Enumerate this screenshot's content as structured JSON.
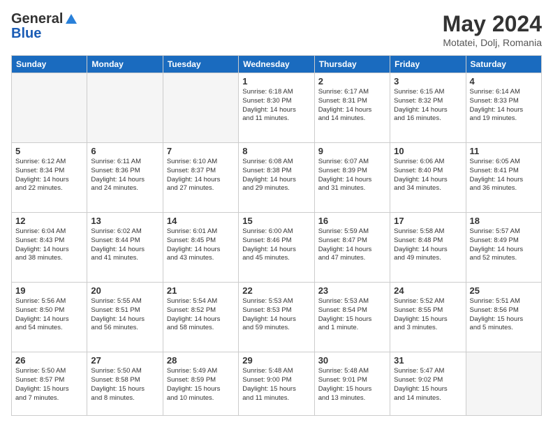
{
  "header": {
    "logo_general": "General",
    "logo_blue": "Blue",
    "month_title": "May 2024",
    "location": "Motatei, Dolj, Romania"
  },
  "days_of_week": [
    "Sunday",
    "Monday",
    "Tuesday",
    "Wednesday",
    "Thursday",
    "Friday",
    "Saturday"
  ],
  "weeks": [
    [
      {
        "day": "",
        "info": ""
      },
      {
        "day": "",
        "info": ""
      },
      {
        "day": "",
        "info": ""
      },
      {
        "day": "1",
        "info": "Sunrise: 6:18 AM\nSunset: 8:30 PM\nDaylight: 14 hours\nand 11 minutes."
      },
      {
        "day": "2",
        "info": "Sunrise: 6:17 AM\nSunset: 8:31 PM\nDaylight: 14 hours\nand 14 minutes."
      },
      {
        "day": "3",
        "info": "Sunrise: 6:15 AM\nSunset: 8:32 PM\nDaylight: 14 hours\nand 16 minutes."
      },
      {
        "day": "4",
        "info": "Sunrise: 6:14 AM\nSunset: 8:33 PM\nDaylight: 14 hours\nand 19 minutes."
      }
    ],
    [
      {
        "day": "5",
        "info": "Sunrise: 6:12 AM\nSunset: 8:34 PM\nDaylight: 14 hours\nand 22 minutes."
      },
      {
        "day": "6",
        "info": "Sunrise: 6:11 AM\nSunset: 8:36 PM\nDaylight: 14 hours\nand 24 minutes."
      },
      {
        "day": "7",
        "info": "Sunrise: 6:10 AM\nSunset: 8:37 PM\nDaylight: 14 hours\nand 27 minutes."
      },
      {
        "day": "8",
        "info": "Sunrise: 6:08 AM\nSunset: 8:38 PM\nDaylight: 14 hours\nand 29 minutes."
      },
      {
        "day": "9",
        "info": "Sunrise: 6:07 AM\nSunset: 8:39 PM\nDaylight: 14 hours\nand 31 minutes."
      },
      {
        "day": "10",
        "info": "Sunrise: 6:06 AM\nSunset: 8:40 PM\nDaylight: 14 hours\nand 34 minutes."
      },
      {
        "day": "11",
        "info": "Sunrise: 6:05 AM\nSunset: 8:41 PM\nDaylight: 14 hours\nand 36 minutes."
      }
    ],
    [
      {
        "day": "12",
        "info": "Sunrise: 6:04 AM\nSunset: 8:43 PM\nDaylight: 14 hours\nand 38 minutes."
      },
      {
        "day": "13",
        "info": "Sunrise: 6:02 AM\nSunset: 8:44 PM\nDaylight: 14 hours\nand 41 minutes."
      },
      {
        "day": "14",
        "info": "Sunrise: 6:01 AM\nSunset: 8:45 PM\nDaylight: 14 hours\nand 43 minutes."
      },
      {
        "day": "15",
        "info": "Sunrise: 6:00 AM\nSunset: 8:46 PM\nDaylight: 14 hours\nand 45 minutes."
      },
      {
        "day": "16",
        "info": "Sunrise: 5:59 AM\nSunset: 8:47 PM\nDaylight: 14 hours\nand 47 minutes."
      },
      {
        "day": "17",
        "info": "Sunrise: 5:58 AM\nSunset: 8:48 PM\nDaylight: 14 hours\nand 49 minutes."
      },
      {
        "day": "18",
        "info": "Sunrise: 5:57 AM\nSunset: 8:49 PM\nDaylight: 14 hours\nand 52 minutes."
      }
    ],
    [
      {
        "day": "19",
        "info": "Sunrise: 5:56 AM\nSunset: 8:50 PM\nDaylight: 14 hours\nand 54 minutes."
      },
      {
        "day": "20",
        "info": "Sunrise: 5:55 AM\nSunset: 8:51 PM\nDaylight: 14 hours\nand 56 minutes."
      },
      {
        "day": "21",
        "info": "Sunrise: 5:54 AM\nSunset: 8:52 PM\nDaylight: 14 hours\nand 58 minutes."
      },
      {
        "day": "22",
        "info": "Sunrise: 5:53 AM\nSunset: 8:53 PM\nDaylight: 14 hours\nand 59 minutes."
      },
      {
        "day": "23",
        "info": "Sunrise: 5:53 AM\nSunset: 8:54 PM\nDaylight: 15 hours\nand 1 minute."
      },
      {
        "day": "24",
        "info": "Sunrise: 5:52 AM\nSunset: 8:55 PM\nDaylight: 15 hours\nand 3 minutes."
      },
      {
        "day": "25",
        "info": "Sunrise: 5:51 AM\nSunset: 8:56 PM\nDaylight: 15 hours\nand 5 minutes."
      }
    ],
    [
      {
        "day": "26",
        "info": "Sunrise: 5:50 AM\nSunset: 8:57 PM\nDaylight: 15 hours\nand 7 minutes."
      },
      {
        "day": "27",
        "info": "Sunrise: 5:50 AM\nSunset: 8:58 PM\nDaylight: 15 hours\nand 8 minutes."
      },
      {
        "day": "28",
        "info": "Sunrise: 5:49 AM\nSunset: 8:59 PM\nDaylight: 15 hours\nand 10 minutes."
      },
      {
        "day": "29",
        "info": "Sunrise: 5:48 AM\nSunset: 9:00 PM\nDaylight: 15 hours\nand 11 minutes."
      },
      {
        "day": "30",
        "info": "Sunrise: 5:48 AM\nSunset: 9:01 PM\nDaylight: 15 hours\nand 13 minutes."
      },
      {
        "day": "31",
        "info": "Sunrise: 5:47 AM\nSunset: 9:02 PM\nDaylight: 15 hours\nand 14 minutes."
      },
      {
        "day": "",
        "info": ""
      }
    ]
  ]
}
